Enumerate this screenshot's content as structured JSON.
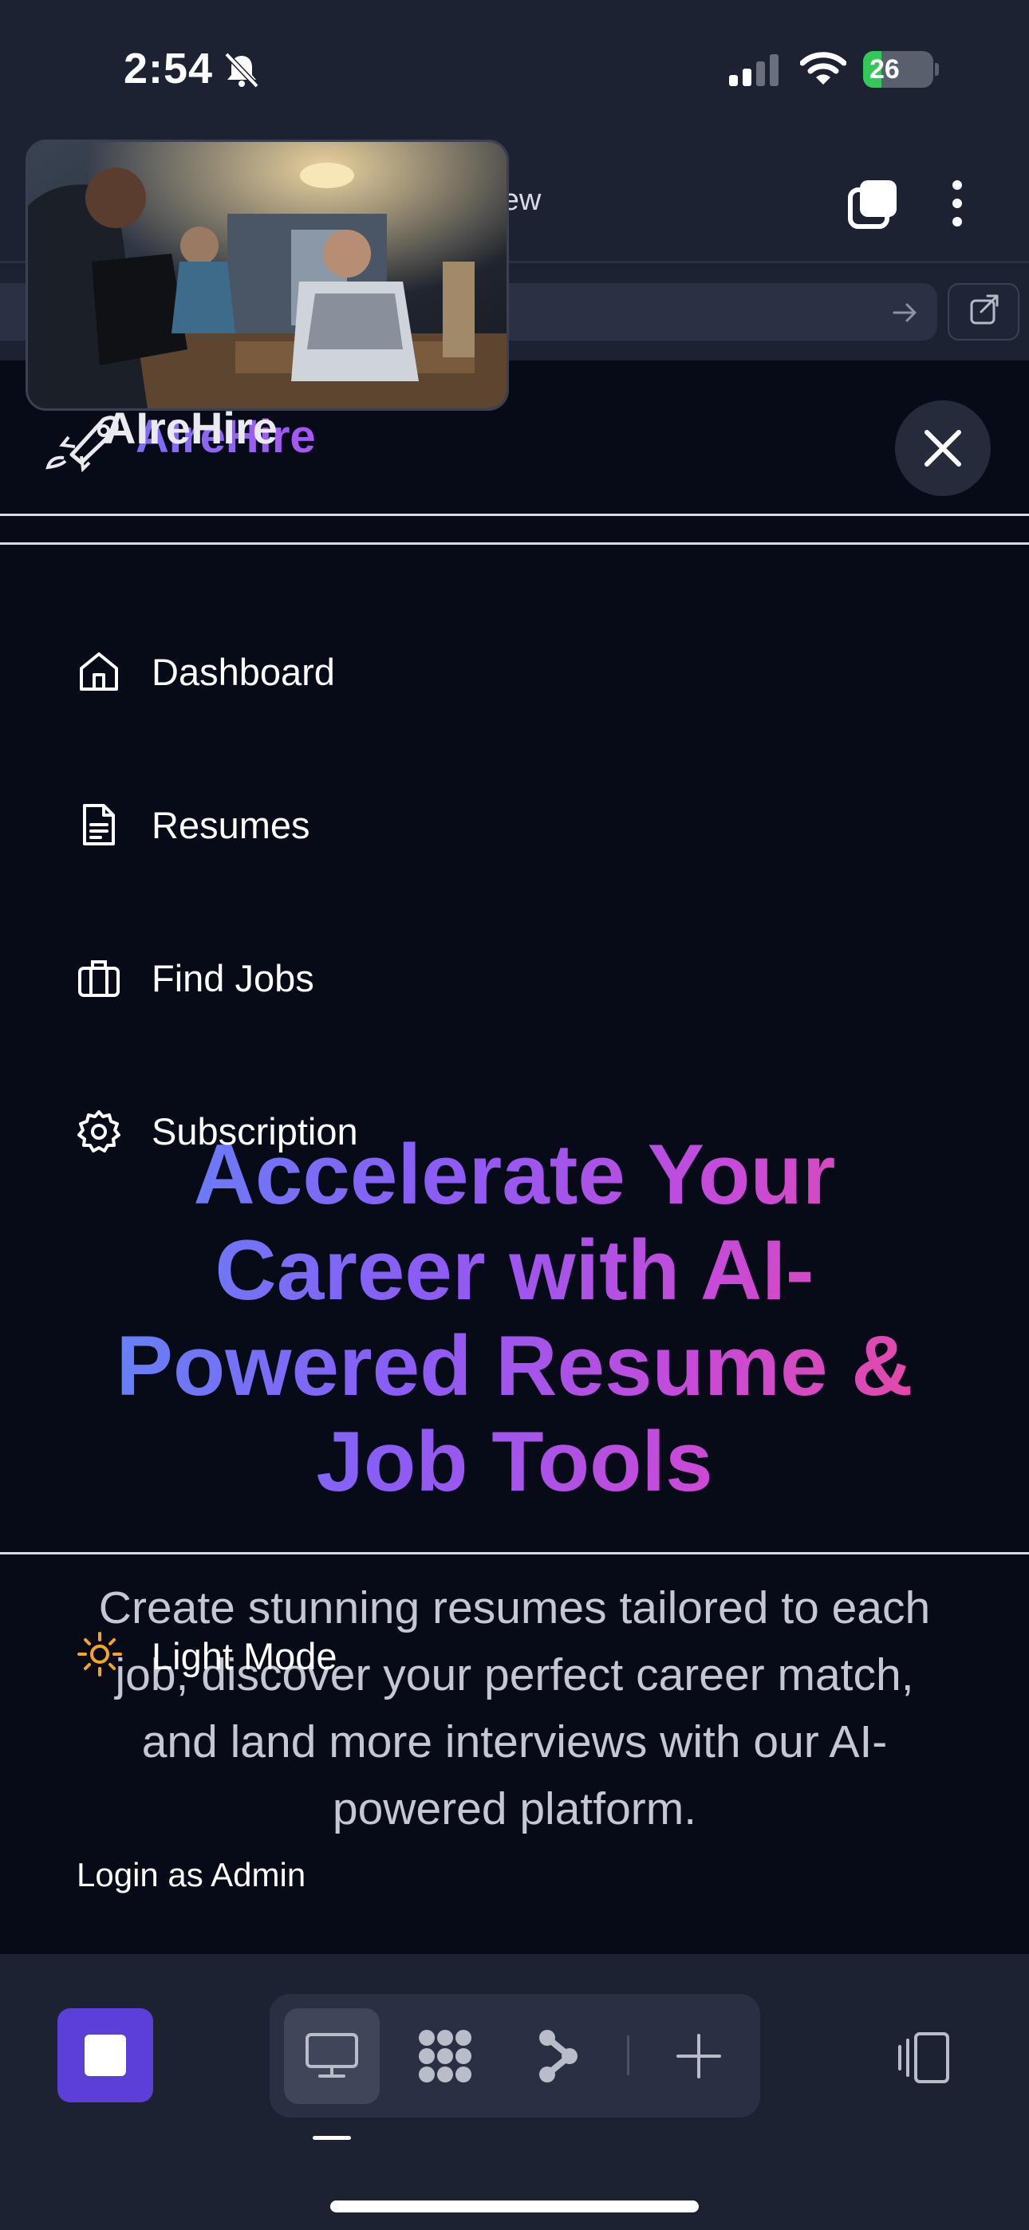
{
  "status_bar": {
    "time": "2:54",
    "battery_level": "26",
    "battery_fraction": 0.26,
    "icons": [
      "mute-icon",
      "signal-icon",
      "wifi-icon",
      "battery-icon"
    ]
  },
  "browser": {
    "title": "ebview",
    "icons": [
      "tabs-icon",
      "more-icon",
      "arrow-right-icon",
      "external-link-icon"
    ]
  },
  "pip": {
    "content": "video-frame"
  },
  "nav": {
    "logo_gradient": "AIreHire",
    "logo_white": "AIreHire",
    "close_icon": "close-icon",
    "items": [
      {
        "label": "Dashboard",
        "icon": "home-icon"
      },
      {
        "label": "Resumes",
        "icon": "document-icon"
      },
      {
        "label": "Find Jobs",
        "icon": "briefcase-icon"
      },
      {
        "label": "Subscription",
        "icon": "gear-icon"
      }
    ],
    "theme_label": "Light Mode",
    "theme_icon": "sun-icon",
    "admin_link": "Login as Admin"
  },
  "hero": {
    "title": "Accelerate Your Career with AI-Powered Resume & Job Tools",
    "subtitle": "Create stunning resumes tailored to each job, discover your perfect career match, and land more interviews with our AI-powered platform."
  },
  "colors": {
    "background": "#070a17",
    "chrome": "#1d2233",
    "accent": "#5b3fd8",
    "gradient_start": "#5b8bf7",
    "gradient_end": "#ec4899",
    "sun": "#f5a524"
  },
  "toolbar": {
    "icons": [
      "stop-icon",
      "desktop-icon",
      "grid-icon",
      "flow-icon",
      "plus-icon",
      "device-toggle-icon"
    ]
  }
}
